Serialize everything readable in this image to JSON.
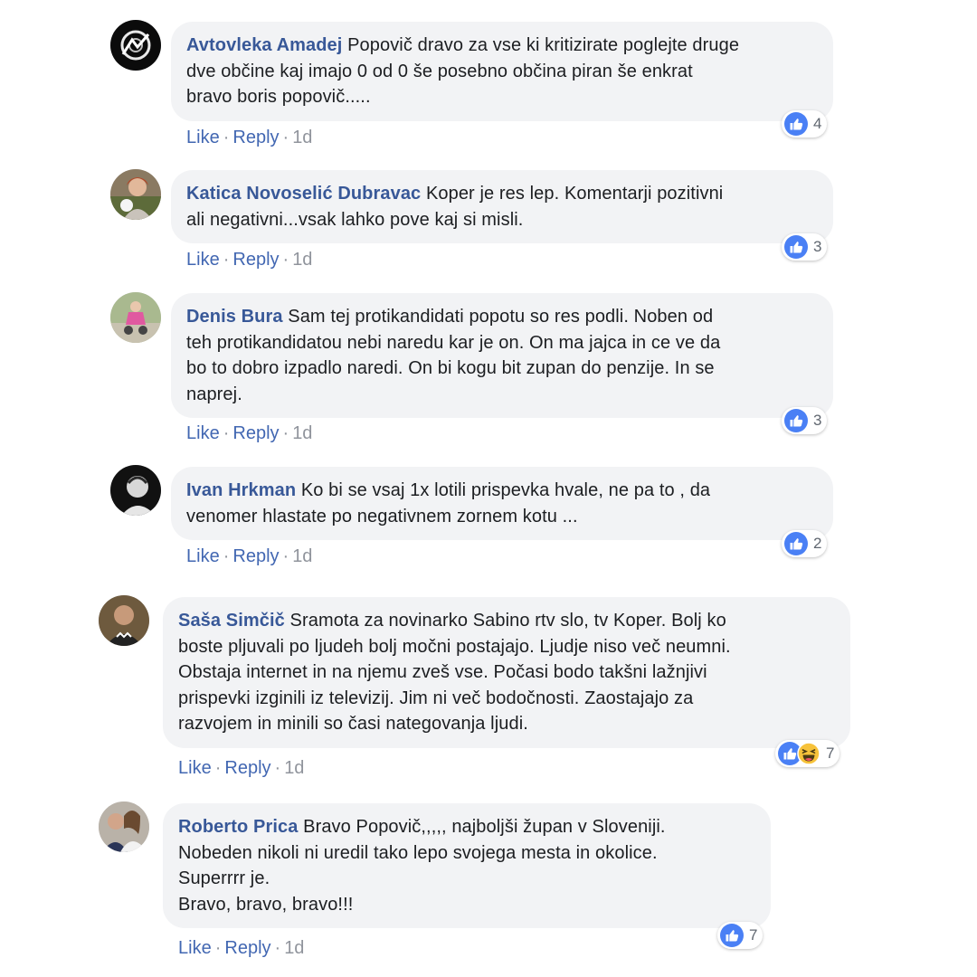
{
  "like_color": "#4267b2",
  "author_color": "#385898",
  "bubble_color": "#f2f3f5",
  "separator": "·",
  "comments": [
    {
      "author": "Avtovleka Amadej",
      "text": "Popovič dravo za vse ki kritizirate poglejte druge\ndve občine kaj imajo 0 od 0 še posebno občina piran še enkrat\nbravo boris popovič.....",
      "reaction_icons": [
        "like-icon"
      ],
      "reaction_count": "4",
      "like_label": "Like",
      "reply_label": "Reply",
      "time": "1d"
    },
    {
      "author": "Katica Novoselić Dubravac",
      "text": "Koper je res lep. Komentarji pozitivni\nali negativni...vsak lahko pove kaj si misli.",
      "reaction_icons": [
        "like-icon"
      ],
      "reaction_count": "3",
      "like_label": "Like",
      "reply_label": "Reply",
      "time": "1d"
    },
    {
      "author": "Denis Bura",
      "text": "Sam tej protikandidati popotu so res podli. Noben od\nteh protikandidatou nebi naredu kar je on. On ma jajca in ce ve da\nbo to dobro izpadlo naredi. On bi kogu bit zupan do penzije. In se\nnaprej.",
      "reaction_icons": [
        "like-icon"
      ],
      "reaction_count": "3",
      "like_label": "Like",
      "reply_label": "Reply",
      "time": "1d"
    },
    {
      "author": "Ivan Hrkman",
      "text": "Ko bi se vsaj 1x lotili prispevka hvale, ne pa to , da\nvenomer hlastate po negativnem zornem kotu ...",
      "reaction_icons": [
        "like-icon"
      ],
      "reaction_count": "2",
      "like_label": "Like",
      "reply_label": "Reply",
      "time": "1d"
    },
    {
      "author": "Saša Simčič",
      "text": "Sramota za novinarko Sabino rtv slo, tv Koper. Bolj ko\nboste pljuvali po ljudeh bolj močni postajajo. Ljudje niso več neumni.\nObstaja internet in na njemu zveš vse. Počasi bodo takšni lažnjivi\nprispevki izginili iz televizij. Jim ni več bodočnosti. Zaostajajo za\nrazvojem in minili so časi nategovanja ljudi.",
      "reaction_icons": [
        "like-icon",
        "haha-icon"
      ],
      "reaction_count": "7",
      "like_label": "Like",
      "reply_label": "Reply",
      "time": "1d"
    },
    {
      "author": "Roberto Prica",
      "text": "Bravo Popovič,,,,, najboljši župan v Sloveniji.\nNobeden nikoli ni uredil tako lepo svojega mesta in okolice.\nSuperrrr je.\nBravo, bravo, bravo!!!",
      "reaction_icons": [
        "like-icon"
      ],
      "reaction_count": "7",
      "like_label": "Like",
      "reply_label": "Reply",
      "time": "1d"
    }
  ]
}
